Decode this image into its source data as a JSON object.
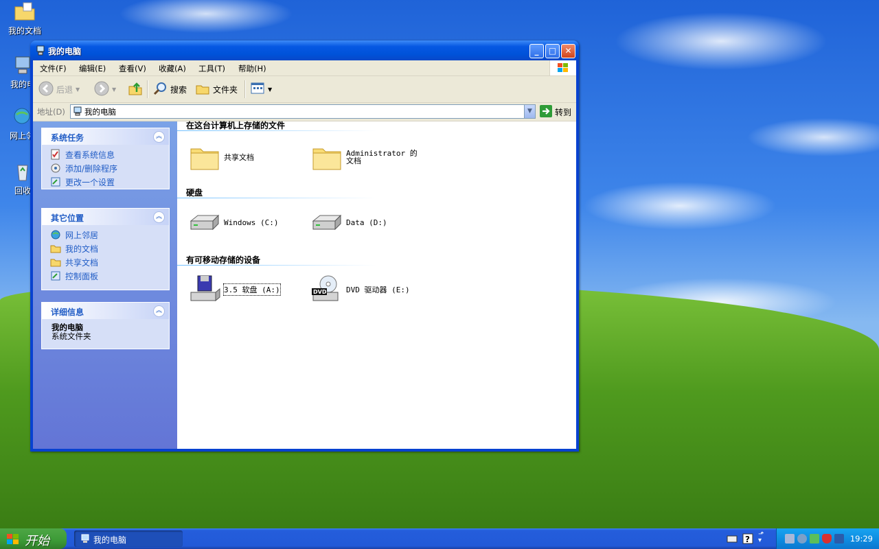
{
  "desktop": {
    "icons": [
      {
        "label": "我的文档"
      },
      {
        "label": "我的电"
      },
      {
        "label": "网上邻"
      },
      {
        "label": "回收"
      }
    ]
  },
  "window": {
    "title": "我的电脑",
    "menu": [
      "文件(F)",
      "编辑(E)",
      "查看(V)",
      "收藏(A)",
      "工具(T)",
      "帮助(H)"
    ],
    "toolbar": {
      "back": "后退",
      "search": "搜索",
      "folders": "文件夹"
    },
    "address": {
      "label": "地址(D)",
      "value": "我的电脑",
      "go": "转到"
    },
    "sidebar": {
      "system_tasks": {
        "title": "系统任务",
        "items": [
          "查看系统信息",
          "添加/删除程序",
          "更改一个设置"
        ]
      },
      "other_places": {
        "title": "其它位置",
        "items": [
          "网上邻居",
          "我的文档",
          "共享文档",
          "控制面板"
        ]
      },
      "details": {
        "title": "详细信息",
        "name": "我的电脑",
        "type": "系统文件夹"
      }
    },
    "groups": {
      "stored_files": {
        "title": "在这台计算机上存储的文件",
        "items": [
          "共享文档",
          "Administrator 的文档"
        ]
      },
      "hard_disks": {
        "title": "硬盘",
        "items": [
          "Windows (C:)",
          "Data (D:)"
        ]
      },
      "removable": {
        "title": "有可移动存储的设备",
        "items": [
          "3.5 软盘 (A:)",
          "DVD 驱动器 (E:)"
        ]
      }
    }
  },
  "taskbar": {
    "start": "开始",
    "task": "我的电脑",
    "clock": "19:29"
  },
  "colors": {
    "titlebar": "#0052d9",
    "sidebar_link": "#215dc6",
    "start_green": "#3c9a36",
    "tray_blue": "#0f8ee2"
  }
}
